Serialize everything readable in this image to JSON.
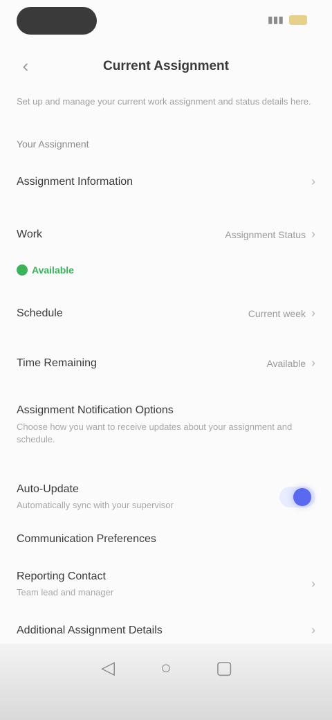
{
  "status_bar": {
    "time": "",
    "battery_icon": "battery-icon"
  },
  "header": {
    "title": "Current Assignment",
    "back_icon": "chevron-left-icon"
  },
  "intro": "Set up and manage your current work assignment and status details here.",
  "section_label": "Your Assignment",
  "rows": [
    {
      "label": "Assignment Information",
      "value": ""
    },
    {
      "label": "Work",
      "value": "Assignment Status"
    },
    {
      "label": "Schedule",
      "value": "Current week"
    },
    {
      "label": "Time Remaining",
      "value": "Available"
    }
  ],
  "badge": "Available",
  "notifications": {
    "label": "Assignment Notification Options",
    "desc": "Choose how you want to receive updates about your assignment and schedule."
  },
  "auto_update": {
    "label": "Auto-Update",
    "desc": "Automatically sync with your supervisor",
    "enabled": true
  },
  "link_text": "Communication Preferences",
  "bottom_rows": [
    {
      "label": "Reporting Contact",
      "desc": "Team lead and manager"
    },
    {
      "label": "Additional Assignment Details",
      "desc": ""
    }
  ],
  "nav": {
    "back": "back-icon",
    "home": "home-icon",
    "recent": "recents-icon"
  }
}
